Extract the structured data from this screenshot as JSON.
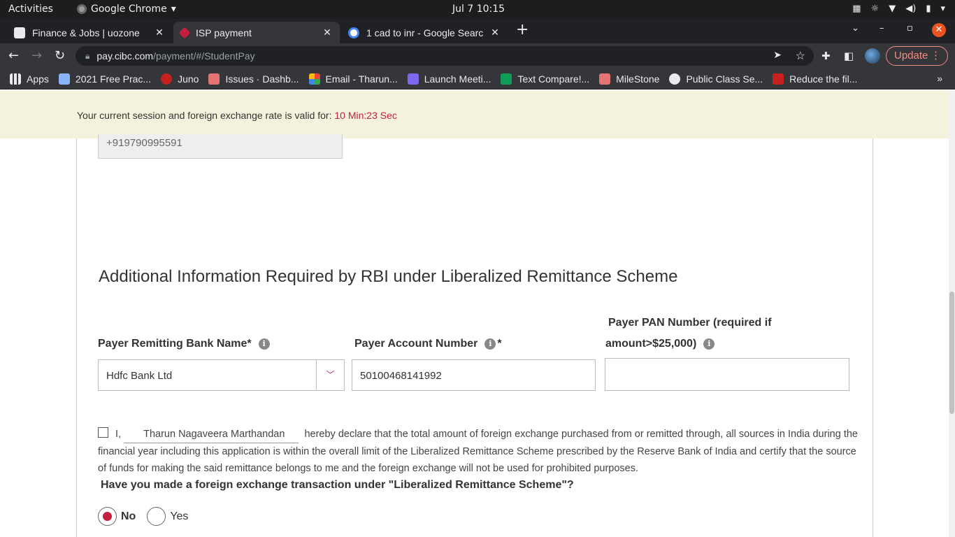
{
  "system_bar": {
    "activities": "Activities",
    "app_name": "Google Chrome",
    "clock": "Jul 7  10:15"
  },
  "tabs": [
    {
      "title": "Finance & Jobs | uozone",
      "active": false
    },
    {
      "title": "ISP payment",
      "active": true
    },
    {
      "title": "1 cad to inr - Google Searc",
      "active": false
    }
  ],
  "toolbar": {
    "url_host": "pay.cibc.com",
    "url_path": "/payment/#/StudentPay",
    "update_label": "Update"
  },
  "bookmarks": [
    {
      "label": "Apps",
      "color": "#e8eaed"
    },
    {
      "label": "2021 Free Prac...",
      "color": "#8ab4f8"
    },
    {
      "label": "Juno",
      "color": "#c5221f"
    },
    {
      "label": "Issues · Dashb...",
      "color": "#e57373"
    },
    {
      "label": "Email - Tharun...",
      "color": "#fbbc04"
    },
    {
      "label": "Launch Meeti...",
      "color": "#7b68ee"
    },
    {
      "label": "Text Compare!...",
      "color": "#0f9d58"
    },
    {
      "label": "MileStone",
      "color": "#e57373"
    },
    {
      "label": "Public Class Se...",
      "color": "#e8eaed"
    },
    {
      "label": "Reduce the fil...",
      "color": "#c5221f"
    }
  ],
  "session": {
    "message": "Your current session and foreign exchange rate is valid for: ",
    "timer": "10 Min:23 Sec"
  },
  "form": {
    "phone_value": "+919790995591",
    "section_title": "Additional Information Required by RBI under Liberalized Remittance Scheme",
    "bank_label": "Payer Remitting Bank Name*",
    "bank_value": "Hdfc Bank Ltd",
    "account_label": "Payer Account Number",
    "account_required": "*",
    "account_value": "50100468141992",
    "pan_label_line1": "Payer PAN Number (required if",
    "pan_label_line2": "amount>$25,000)",
    "pan_value": "",
    "declaration_prefix": "I,",
    "declaration_name": "Tharun Nagaveera Marthandan",
    "declaration_text": "hereby declare that the total amount of foreign exchange purchased from or remitted through, all sources in India during the financial year including this application is within the overall limit of the Liberalized Remittance Scheme prescribed by the Reserve Bank of India and certify that the source of funds for making the said remittance belongs to me and the foreign exchange will not be used for prohibited purposes.",
    "question": "Have you made a foreign exchange transaction under \"Liberalized Remittance Scheme\"?",
    "radio_no": "No",
    "radio_yes": "Yes",
    "selected_radio": "No"
  },
  "colors": {
    "accent_red": "#c41f3e",
    "session_bg": "#f4f2dc",
    "chrome_dark": "#202124",
    "chrome_toolbar": "#35363a"
  }
}
